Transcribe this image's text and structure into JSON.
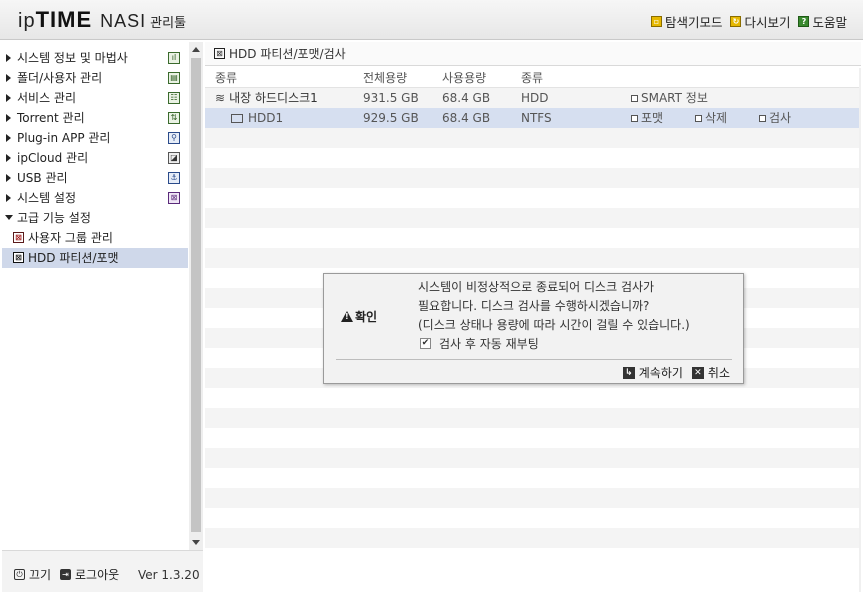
{
  "header": {
    "logo_ip": "ip",
    "logo_time": "TIME",
    "logo_nas": "NASI",
    "logo_mgr": "관리툴",
    "nav": [
      {
        "label": "탐색기모드",
        "icon": "explorer-icon"
      },
      {
        "label": "다시보기",
        "icon": "refresh-icon"
      },
      {
        "label": "도움말",
        "icon": "help-icon"
      }
    ]
  },
  "sidebar": {
    "items": [
      {
        "label": "시스템 정보 및 마법사"
      },
      {
        "label": "폴더/사용자 관리"
      },
      {
        "label": "서비스 관리"
      },
      {
        "label": "Torrent 관리"
      },
      {
        "label": "Plug-in APP 관리"
      },
      {
        "label": "ipCloud 관리"
      },
      {
        "label": "USB 관리"
      },
      {
        "label": "시스템 설정"
      }
    ],
    "expanded": {
      "label": "고급 기능 설정"
    },
    "subitems": [
      {
        "label": "사용자 그룹 관리"
      },
      {
        "label": "HDD 파티션/포맷",
        "selected": true
      }
    ],
    "footer": {
      "power_label": "끄기",
      "logout_label": "로그아웃",
      "version": "Ver 1.3.20"
    }
  },
  "main": {
    "breadcrumb": "HDD 파티션/포맷/검사",
    "columns": [
      "종류",
      "전체용량",
      "사용용량",
      "종류"
    ],
    "disk": {
      "name": "내장 하드디스크1",
      "total": "931.5 GB",
      "used": "68.4 GB",
      "type": "HDD",
      "action": "SMART 정보"
    },
    "partition": {
      "name": "HDD1",
      "total": "929.5 GB",
      "used": "68.4 GB",
      "type": "NTFS",
      "actions": [
        "포맷",
        "삭제",
        "검사"
      ]
    }
  },
  "dialog": {
    "title": "확인",
    "message": [
      "시스템이 비정상적으로 종료되어 디스크 검사가",
      "필요합니다. 디스크 검사를 수행하시겠습니까?",
      "(디스크 상태나 용량에 따라 시간이 걸릴 수 있습니다.)"
    ],
    "checkbox_label": "검사 후 자동 재부팅",
    "checkbox_checked": true,
    "continue_label": "계속하기",
    "cancel_label": "취소"
  }
}
